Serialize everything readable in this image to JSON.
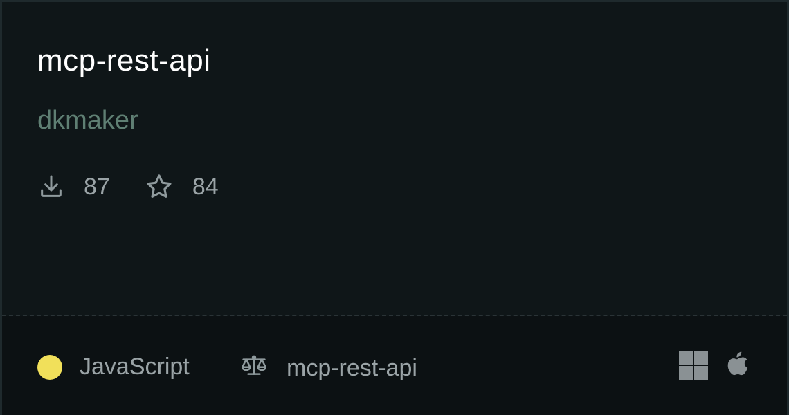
{
  "repo": {
    "name": "mcp-rest-api",
    "author": "dkmaker"
  },
  "stats": {
    "downloads": {
      "icon": "download-icon",
      "value": "87"
    },
    "stars": {
      "icon": "star-icon",
      "value": "84"
    }
  },
  "footer": {
    "language": {
      "label": "JavaScript",
      "color": "#f1e05a"
    },
    "license": {
      "icon": "scale-icon",
      "label": "mcp-rest-api"
    },
    "platforms": [
      "windows-icon",
      "apple-icon"
    ]
  }
}
